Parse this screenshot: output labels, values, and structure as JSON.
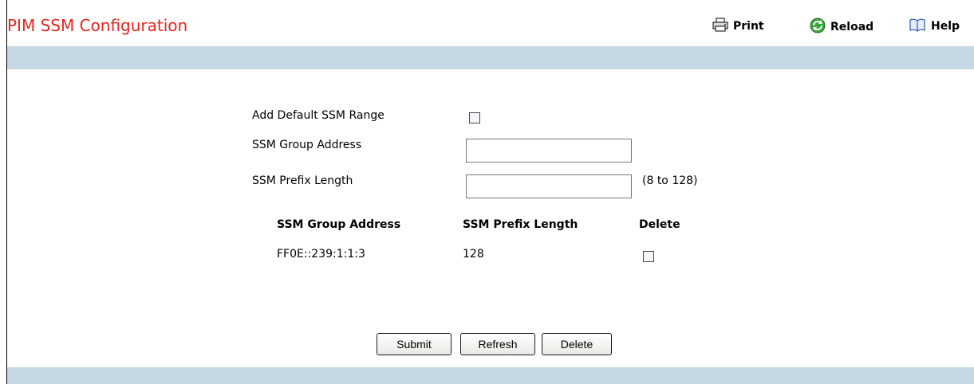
{
  "page": {
    "title": "PIM SSM Configuration"
  },
  "toolbar": {
    "print_label": "Print",
    "reload_label": "Reload",
    "help_label": "Help"
  },
  "form": {
    "add_default_label": "Add Default SSM Range",
    "add_default_checked": false,
    "group_address_label": "SSM Group Address",
    "group_address_value": "",
    "prefix_length_label": "SSM Prefix Length",
    "prefix_length_value": "",
    "prefix_length_hint": "(8 to 128)"
  },
  "table": {
    "headers": [
      "SSM Group Address",
      "SSM Prefix Length",
      "Delete"
    ],
    "rows": [
      {
        "group_address": "FF0E::239:1:1:3",
        "prefix_length": "128",
        "delete": false
      }
    ]
  },
  "buttons": {
    "submit": "Submit",
    "refresh": "Refresh",
    "delete": "Delete"
  },
  "colors": {
    "title": "#e8251f",
    "band": "#c6d8e4"
  },
  "icons": {
    "print": "printer-icon",
    "reload": "reload-icon",
    "help": "help-book-icon"
  }
}
